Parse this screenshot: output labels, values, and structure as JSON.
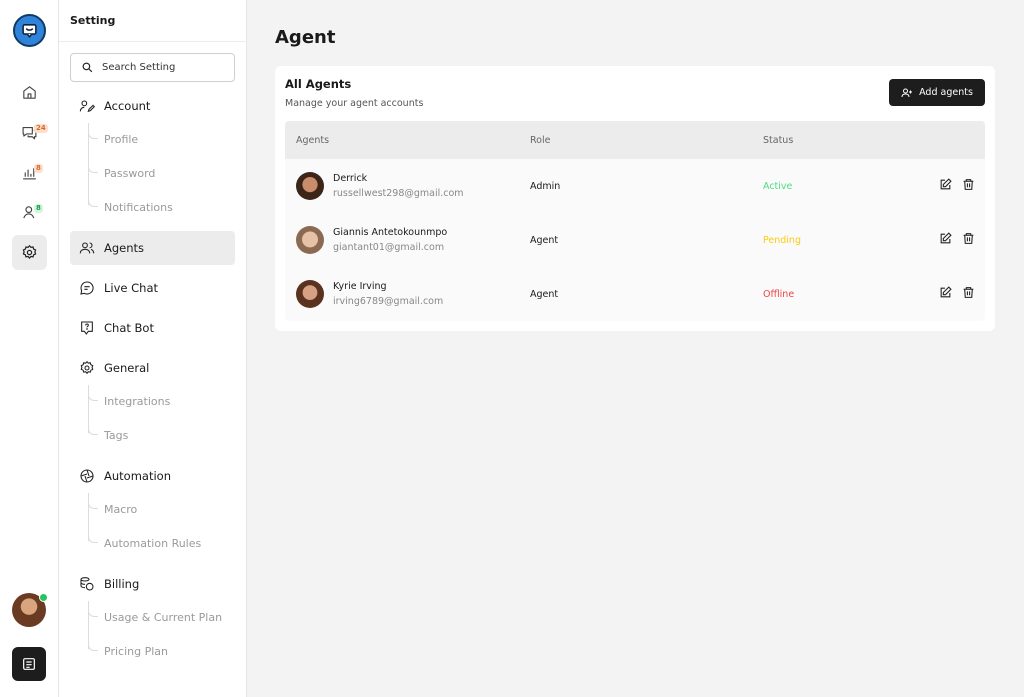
{
  "sidebar": {
    "title": "Setting",
    "search_placeholder": "Search Setting",
    "items": {
      "account": "Account",
      "profile": "Profile",
      "password": "Password",
      "notifications": "Notifications",
      "agents": "Agents",
      "live_chat": "Live Chat",
      "chat_bot": "Chat Bot",
      "general": "General",
      "integrations": "Integrations",
      "tags": "Tags",
      "automation": "Automation",
      "macro": "Macro",
      "automation_rules": "Automation Rules",
      "billing": "Billing",
      "usage_plan": "Usage & Current Plan",
      "pricing_plan": "Pricing Plan"
    }
  },
  "rail": {
    "chat_badge": "24",
    "reports_badge": "8",
    "contacts_badge": "8"
  },
  "main": {
    "title": "Agent",
    "card_title": "All Agents",
    "card_subtitle": "Manage your agent accounts",
    "add_button": "Add agents",
    "columns": [
      "Agents",
      "Role",
      "Status"
    ],
    "rows": [
      {
        "name": "Derrick",
        "email": "russellwest298@gmail.com",
        "role": "Admin",
        "status": "Active",
        "status_color": "#4ade80"
      },
      {
        "name": "Giannis Antetokounmpo",
        "email": "giantant01@gmail.com",
        "role": "Agent",
        "status": "Pending",
        "status_color": "#facc15"
      },
      {
        "name": "Kyrie Irving",
        "email": "irving6789@gmail.com",
        "role": "Agent",
        "status": "Offline",
        "status_color": "#ef4444"
      }
    ]
  },
  "colors": {
    "accent_dark": "#1d1d1d",
    "logo_blue": "#2f83d8",
    "online_green": "#22c55e",
    "badge_chat": "#f59e5b",
    "badge_reports": "#f59e5b",
    "badge_contacts": "#22c55e"
  }
}
